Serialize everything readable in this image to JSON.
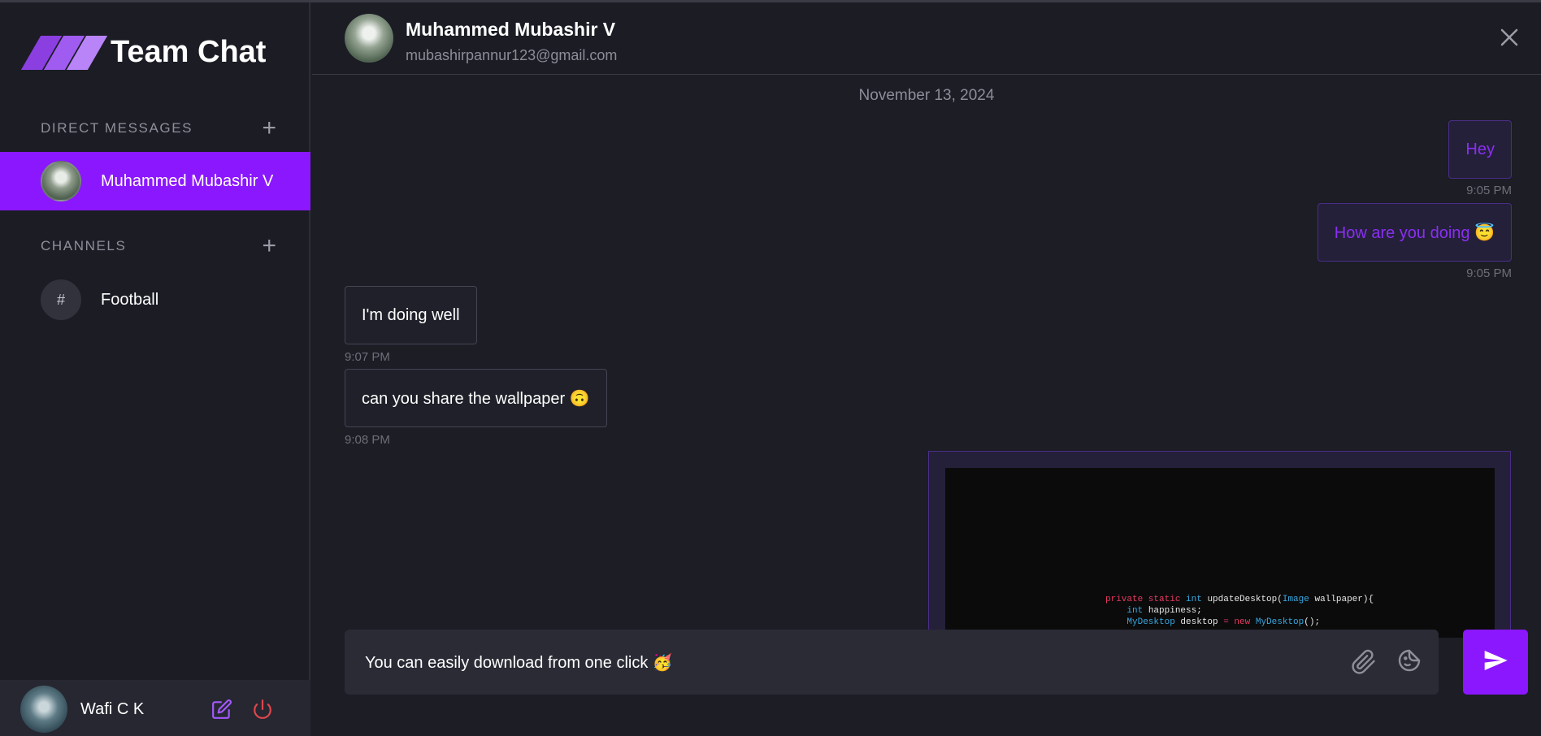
{
  "app": {
    "title": "Team Chat"
  },
  "sidebar": {
    "direct_messages_label": "DIRECT MESSAGES",
    "channels_label": "CHANNELS",
    "dm_items": [
      {
        "name": "Muhammed Mubashir V",
        "active": true
      }
    ],
    "channels": [
      {
        "symbol": "#",
        "name": "Football"
      }
    ],
    "profile": {
      "name": "Wafi C K"
    }
  },
  "chat": {
    "header": {
      "name": "Muhammed Mubashir V",
      "email": "mubashirpannur123@gmail.com"
    },
    "date_separator": "November 13, 2024",
    "messages": [
      {
        "direction": "out",
        "text": "Hey",
        "time": "9:05 PM"
      },
      {
        "direction": "out",
        "text": "How are you doing 😇",
        "time": "9:05 PM"
      },
      {
        "direction": "in",
        "text": "I'm doing well",
        "time": "9:07 PM"
      },
      {
        "direction": "in",
        "text": "can you share the wallpaper 🙃",
        "time": "9:08 PM"
      },
      {
        "direction": "out",
        "type": "image",
        "code_lines": [
          "private static int updateDesktop(Image wallpaper){",
          "    int happiness;",
          "    MyDesktop desktop = new MyDesktop();"
        ]
      }
    ],
    "composer": {
      "value": "You can easily download from one click 🥳"
    }
  },
  "colors": {
    "accent": "#8b17ff",
    "background": "#1c1d25",
    "sidebar": "#1b1c24",
    "danger": "#e0474c"
  },
  "icons": [
    "close-icon",
    "plus-icon",
    "edit-icon",
    "power-icon",
    "paperclip-icon",
    "emoji-icon",
    "send-icon"
  ]
}
